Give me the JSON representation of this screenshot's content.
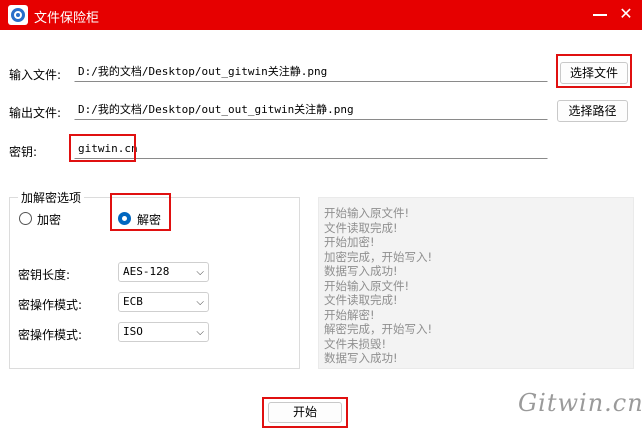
{
  "window": {
    "title": "文件保险柜",
    "minimize_glyph": "—",
    "close_glyph": "✕"
  },
  "input_file": {
    "label": "输入文件:",
    "value": "D:/我的文档/Desktop/out_gitwin关注静.png",
    "button": "选择文件"
  },
  "output_file": {
    "label": "输出文件:",
    "value": "D:/我的文档/Desktop/out_out_gitwin关注静.png",
    "button": "选择路径"
  },
  "key": {
    "label": "密钥:",
    "value": "gitwin.cn"
  },
  "options": {
    "title": "加解密选项",
    "encrypt_label": "加密",
    "decrypt_label": "解密",
    "selected": "解密",
    "key_length": {
      "label": "密钥长度:",
      "value": "AES-128"
    },
    "mode": {
      "label": "密操作模式:",
      "value": "ECB"
    },
    "padding": {
      "label": "密操作模式:",
      "value": "ISO"
    }
  },
  "log": [
    "开始输入原文件!",
    "文件读取完成!",
    "开始加密!",
    "加密完成，开始写入!",
    "数据写入成功!",
    "开始输入原文件!",
    "文件读取完成!",
    "开始解密!",
    "解密完成，开始写入!",
    "文件未损毁!",
    "数据写入成功!"
  ],
  "start_button": "开始",
  "watermark": "Gitwin.cn",
  "colors": {
    "titlebar": "#e60000",
    "highlight": "#e01010",
    "accent": "#0067c0"
  }
}
